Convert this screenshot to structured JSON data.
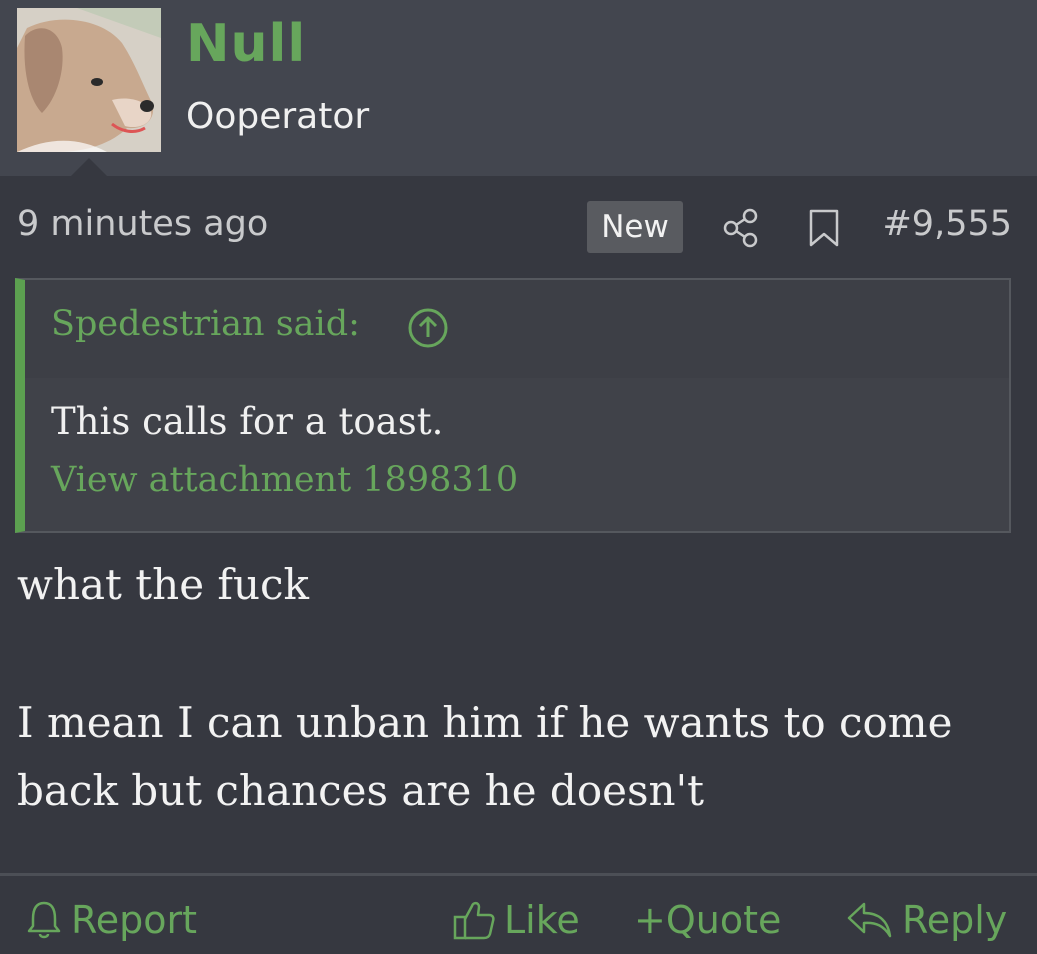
{
  "user": {
    "name": "Null",
    "title": "Ooperator"
  },
  "post": {
    "time": "9 minutes ago",
    "new_badge": "New",
    "number": "#9,555"
  },
  "quote": {
    "author": "Spedestrian said:",
    "text": "This calls for a toast.",
    "attachment": "View attachment 1898310"
  },
  "body": {
    "line1": "what the fuck",
    "line2": "I mean I can unban him if he wants to come",
    "line3": "back but chances are he doesn't"
  },
  "actions": {
    "report": "Report",
    "like": "Like",
    "quote": "+Quote",
    "reply": "Reply"
  },
  "icons": {
    "share": "share-icon",
    "bookmark": "bookmark-icon",
    "up": "arrow-up-circle-icon",
    "bell": "bell-icon",
    "thumb": "thumbs-up-icon",
    "reply": "reply-icon"
  },
  "colors": {
    "accent": "#67a65c",
    "background": "#363840",
    "header": "#43464f"
  }
}
